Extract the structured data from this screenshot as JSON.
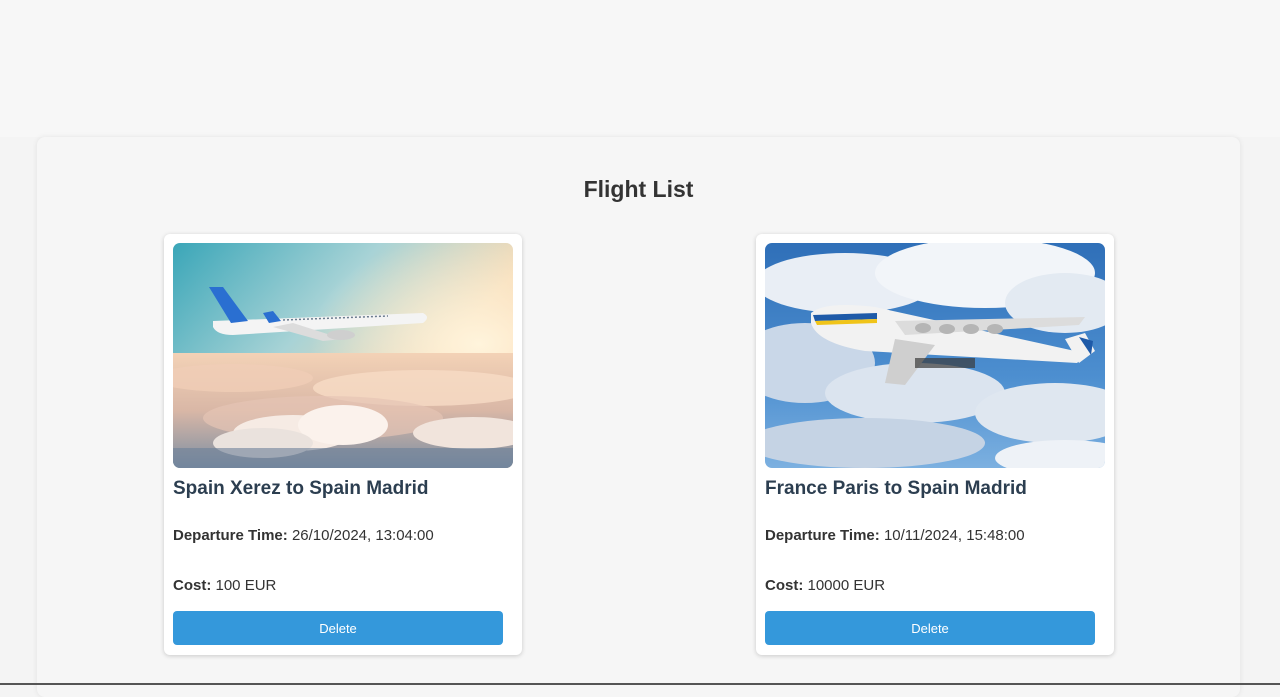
{
  "page": {
    "title": "Flight List"
  },
  "flights": [
    {
      "route": "Spain Xerez to Spain Madrid",
      "departure_label": "Departure Time:",
      "departure_value": "26/10/2024, 13:04:00",
      "cost_label": "Cost:",
      "cost_value": "100 EUR",
      "delete_label": "Delete",
      "image": "airliner-over-sunset-clouds"
    },
    {
      "route": "France Paris to Spain Madrid",
      "departure_label": "Departure Time:",
      "departure_value": "10/11/2024, 15:48:00",
      "cost_label": "Cost:",
      "cost_value": "10000 EUR",
      "delete_label": "Delete",
      "image": "cargo-plane-blue-sky"
    }
  ],
  "colors": {
    "accent": "#3498db",
    "title_text": "#2c3e50"
  }
}
